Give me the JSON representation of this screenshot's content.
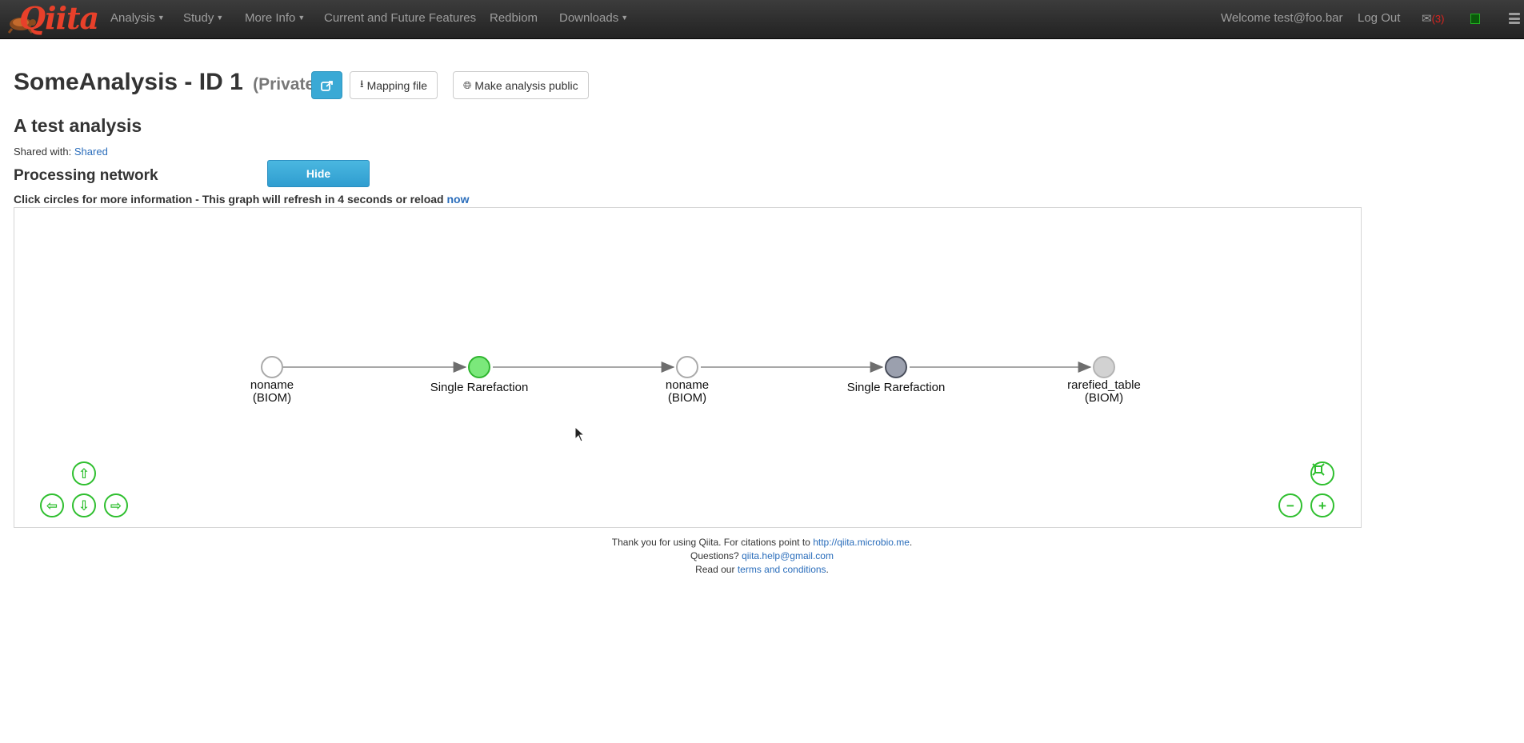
{
  "navbar": {
    "brand": "Qiita",
    "items": [
      {
        "label": "Analysis",
        "caret": true
      },
      {
        "label": "Study",
        "caret": true
      },
      {
        "label": "More Info",
        "caret": true
      },
      {
        "label": "Current and Future Features",
        "caret": false
      },
      {
        "label": "Redbiom",
        "caret": false
      },
      {
        "label": "Downloads",
        "caret": true
      }
    ],
    "welcome": "Welcome test@foo.bar",
    "logout": "Log Out",
    "mail_icon": "✉",
    "mail_count": "(3)"
  },
  "header": {
    "title": "SomeAnalysis - ID 1",
    "privacy": "(Private)",
    "share_icon": "share-icon",
    "mapping_file": "Mapping file",
    "make_public": "Make analysis public",
    "description": "A test analysis",
    "shared_with_label": "Shared with:",
    "shared_with_link": "Shared"
  },
  "network": {
    "heading": "Processing network",
    "hide_label": "Hide",
    "refresh_text": "Click circles for more information - This graph will refresh in 4 seconds or reload",
    "refresh_link": "now",
    "nodes": [
      {
        "line1": "noname",
        "line2": "(BIOM)",
        "fill": "#ffffff",
        "stroke": "#aaaaaa"
      },
      {
        "line1": "Single Rarefaction",
        "line2": "",
        "fill": "#7be87b",
        "stroke": "#2fb52f"
      },
      {
        "line1": "noname",
        "line2": "(BIOM)",
        "fill": "#ffffff",
        "stroke": "#aaaaaa"
      },
      {
        "line1": "Single Rarefaction",
        "line2": "",
        "fill": "#9ba0ae",
        "stroke": "#4a4f5c"
      },
      {
        "line1": "rarefied_table",
        "line2": "(BIOM)",
        "fill": "#d2d2d2",
        "stroke": "#b4b4b4"
      }
    ]
  },
  "footer": {
    "line1_text": "Thank you for using Qiita. For citations point to",
    "line1_link": "http://qiita.microbio.me",
    "line2_text": "Questions?",
    "line2_link": "qiita.help@gmail.com",
    "line3_text": "Read our",
    "line3_link": "terms and conditions"
  }
}
